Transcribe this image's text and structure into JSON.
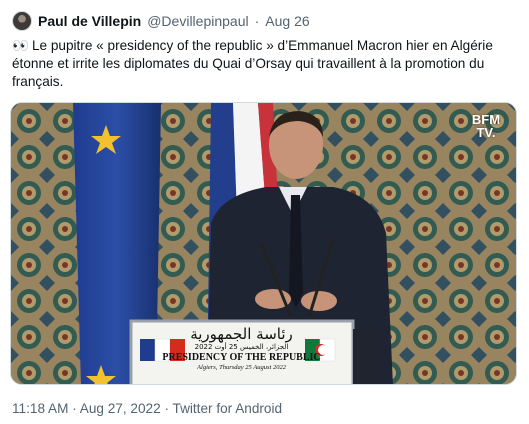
{
  "tweet": {
    "author": {
      "display_name": "Paul de Villepin",
      "handle": "@Devillepinpaul",
      "date": "Aug 26"
    },
    "separator": "·",
    "emoji": "👀",
    "text": "Le pupitre « presidency of the republic » d’Emmanuel Macron hier en Algérie étonne et irrite les diplomates du Quai d’Orsay qui travaillent à la promotion du français.",
    "media": {
      "watermark_line1": "BFM",
      "watermark_line2": "TV.",
      "podium_arabic": "رئاسة الجمهورية",
      "podium_arabic_date": "الجزائر، الخميس 25 أوت 2022",
      "podium_english": "PRESIDENCY OF THE REPUBLIC",
      "podium_place": "Algiers, Thursday 25 August 2022"
    },
    "footer": {
      "time": "11:18 AM",
      "date": "Aug 27, 2022",
      "source": "Twitter for Android"
    }
  }
}
